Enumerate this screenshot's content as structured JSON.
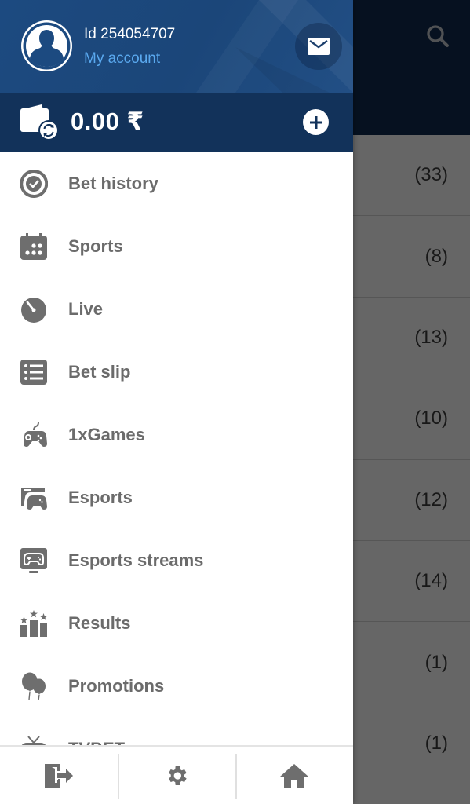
{
  "background": {
    "search_icon": "search-icon",
    "counts": [
      "(33)",
      "(8)",
      "(13)",
      "(10)",
      "(12)",
      "(14)",
      "(1)",
      "(1)"
    ]
  },
  "drawer": {
    "user": {
      "id_text": "Id 254054707",
      "account_link": "My account",
      "avatar_icon": "user-silhouette-icon",
      "mail_icon": "envelope-icon"
    },
    "balance": {
      "amount": "0.00 ₹",
      "wallet_icon": "wallet-refresh-icon",
      "add_icon": "plus-circle-icon"
    },
    "menu": [
      {
        "label": "Bet history",
        "icon": "bet-history-icon"
      },
      {
        "label": "Sports",
        "icon": "calendar-icon"
      },
      {
        "label": "Live",
        "icon": "stopwatch-icon"
      },
      {
        "label": "Bet slip",
        "icon": "list-icon"
      },
      {
        "label": "1xGames",
        "icon": "gamepad-icon"
      },
      {
        "label": "Esports",
        "icon": "esports-icon"
      },
      {
        "label": "Esports streams",
        "icon": "esports-stream-icon"
      },
      {
        "label": "Results",
        "icon": "results-podium-icon"
      },
      {
        "label": "Promotions",
        "icon": "balloons-icon"
      },
      {
        "label": "TVBET",
        "icon": "tv-icon"
      }
    ],
    "bottom_bar": [
      {
        "name": "logout",
        "icon": "logout-icon"
      },
      {
        "name": "settings",
        "icon": "gear-icon"
      },
      {
        "name": "home",
        "icon": "home-icon"
      }
    ]
  },
  "colors": {
    "header_blue": "#1c4a80",
    "balance_bar": "#12325a",
    "link_blue": "#5aa9ef",
    "menu_text": "#6b6b6b",
    "icon_gray": "#6e6e6e"
  }
}
